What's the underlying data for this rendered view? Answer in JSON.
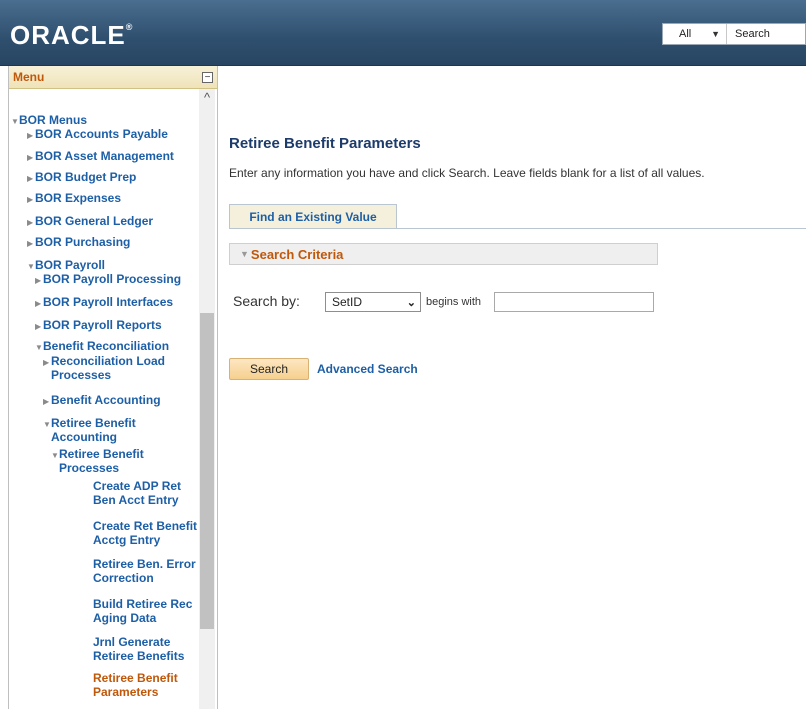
{
  "header": {
    "logo": "ORACLE",
    "logo_mark": "®",
    "search_scope": "All",
    "search_placeholder": "Search"
  },
  "menu": {
    "title": "Menu",
    "items": [
      {
        "label": "BOR Menus"
      },
      {
        "label": "BOR Accounts Payable"
      },
      {
        "label": "BOR Asset Management"
      },
      {
        "label": "BOR Budget Prep"
      },
      {
        "label": "BOR Expenses"
      },
      {
        "label": "BOR General Ledger"
      },
      {
        "label": "BOR Purchasing"
      },
      {
        "label": "BOR Payroll"
      },
      {
        "label": "BOR Payroll Processing"
      },
      {
        "label": "BOR Payroll Interfaces"
      },
      {
        "label": "BOR Payroll Reports"
      },
      {
        "label": "Benefit Reconciliation"
      },
      {
        "label": "Reconciliation Load Processes"
      },
      {
        "label": "Benefit Accounting"
      },
      {
        "label": "Retiree Benefit Accounting"
      },
      {
        "label": "Retiree Benefit Processes"
      },
      {
        "label": "Create ADP Ret Ben Acct Entry"
      },
      {
        "label": "Create Ret Benefit Acctg Entry"
      },
      {
        "label": "Retiree Ben. Error Correction"
      },
      {
        "label": "Build Retiree Rec Aging Data"
      },
      {
        "label": "Jrnl Generate Retiree Benefits"
      },
      {
        "label": "Retiree Benefit Parameters"
      }
    ]
  },
  "main": {
    "page_title": "Retiree Benefit Parameters",
    "instructions": "Enter any information you have and click Search. Leave fields blank for a list of all values.",
    "tab_label": "Find an Existing Value",
    "section_title": "Search Criteria",
    "search_by_label": "Search by:",
    "search_by_value": "SetID",
    "operator_label": "begins with",
    "search_value": "",
    "search_button": "Search",
    "advanced_link": "Advanced Search"
  },
  "colors": {
    "header_bg": "#2f4f6e",
    "link": "#1d5fa6",
    "accent": "#c0580b",
    "title": "#1d3b6b"
  }
}
